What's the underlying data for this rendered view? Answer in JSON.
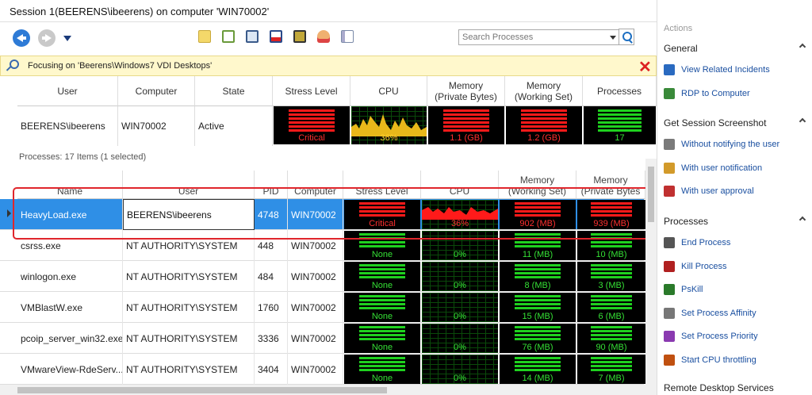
{
  "window": {
    "title": "Session 1(BEERENS\\ibeerens) on computer 'WIN70002'"
  },
  "toolbar": {
    "search_placeholder": "Search Processes",
    "icons": [
      "back-icon",
      "forward-icon",
      "dropdown-icon",
      "folder-icon",
      "list-icon",
      "window-icon",
      "screen-icon",
      "chip-icon",
      "user-icon",
      "id-card-icon",
      "search-icon"
    ]
  },
  "focus": {
    "text": "Focusing on 'Beerens\\Windows7 VDI Desktops'",
    "close": "✕"
  },
  "session": {
    "headers": {
      "user": "User",
      "computer": "Computer",
      "state": "State",
      "stress": "Stress Level",
      "cpu": "CPU",
      "mem_private": "Memory\n(Private Bytes)",
      "mem_working": "Memory\n(Working Set)",
      "processes": "Processes"
    },
    "row": {
      "user": "BEERENS\\ibeerens",
      "computer": "WIN70002",
      "state": "Active",
      "stress": "Critical",
      "cpu": "36%",
      "mem_private": "1.1 (GB)",
      "mem_working": "1.2 (GB)",
      "processes": "17"
    }
  },
  "processes": {
    "count": "Processes: 17 Items (1 selected)",
    "headers": {
      "name": "Name",
      "user": "User",
      "pid": "PID",
      "computer": "Computer",
      "stress": "Stress Level",
      "cpu": "CPU",
      "mem_working": "Memory\n(Working Set)",
      "mem_private": "Memory\n(Private Bytes"
    },
    "rows": [
      {
        "name": "HeavyLoad.exe",
        "user": "BEERENS\\ibeerens",
        "pid": "4748",
        "computer": "WIN70002",
        "stress": "Critical",
        "cpu": "36%",
        "mem_working": "902 (MB)",
        "mem_private": "939 (MB)",
        "level": "critical"
      },
      {
        "name": "csrss.exe",
        "user": "NT AUTHORITY\\SYSTEM",
        "pid": "448",
        "computer": "WIN70002",
        "stress": "None",
        "cpu": "0%",
        "mem_working": "11 (MB)",
        "mem_private": "10 (MB)",
        "level": "none"
      },
      {
        "name": "winlogon.exe",
        "user": "NT AUTHORITY\\SYSTEM",
        "pid": "484",
        "computer": "WIN70002",
        "stress": "None",
        "cpu": "0%",
        "mem_working": "8 (MB)",
        "mem_private": "3 (MB)",
        "level": "none"
      },
      {
        "name": "VMBlastW.exe",
        "user": "NT AUTHORITY\\SYSTEM",
        "pid": "1760",
        "computer": "WIN70002",
        "stress": "None",
        "cpu": "0%",
        "mem_working": "15 (MB)",
        "mem_private": "6 (MB)",
        "level": "none"
      },
      {
        "name": "pcoip_server_win32.exe",
        "user": "NT AUTHORITY\\SYSTEM",
        "pid": "3336",
        "computer": "WIN70002",
        "stress": "None",
        "cpu": "0%",
        "mem_working": "76 (MB)",
        "mem_private": "90 (MB)",
        "level": "none"
      },
      {
        "name": "VMwareView-RdeServ...",
        "user": "NT AUTHORITY\\SYSTEM",
        "pid": "3404",
        "computer": "WIN70002",
        "stress": "None",
        "cpu": "0%",
        "mem_working": "14 (MB)",
        "mem_private": "7 (MB)",
        "level": "none"
      }
    ]
  },
  "actions": {
    "title": "Actions",
    "sections": [
      {
        "label": "General",
        "items": [
          {
            "label": "View Related Incidents",
            "icon": "link-icon"
          },
          {
            "label": "RDP to Computer",
            "icon": "remote-desktop-icon"
          }
        ]
      },
      {
        "label": "Get Session Screenshot",
        "items": [
          {
            "label": "Without notifying the user",
            "icon": "camera-icon"
          },
          {
            "label": "With user notification",
            "icon": "camera-notify-icon"
          },
          {
            "label": "With user approval",
            "icon": "camera-approval-icon"
          }
        ]
      },
      {
        "label": "Processes",
        "items": [
          {
            "label": "End Process",
            "icon": "end-process-icon"
          },
          {
            "label": "Kill Process",
            "icon": "kill-process-icon"
          },
          {
            "label": "PsKill",
            "icon": "pskill-icon"
          },
          {
            "label": "Set Process Affinity",
            "icon": "gear-icon"
          },
          {
            "label": "Set Process Priority",
            "icon": "priority-icon"
          },
          {
            "label": "Start CPU throttling",
            "icon": "throttle-icon"
          }
        ]
      },
      {
        "label": "Remote Desktop Services",
        "items": []
      }
    ]
  },
  "colors": {
    "critical": "#ff1a1a",
    "ok": "#1fd11f",
    "selection": "#2f8fe6",
    "link": "#1a4fa0",
    "highlight": "#e0262c"
  }
}
